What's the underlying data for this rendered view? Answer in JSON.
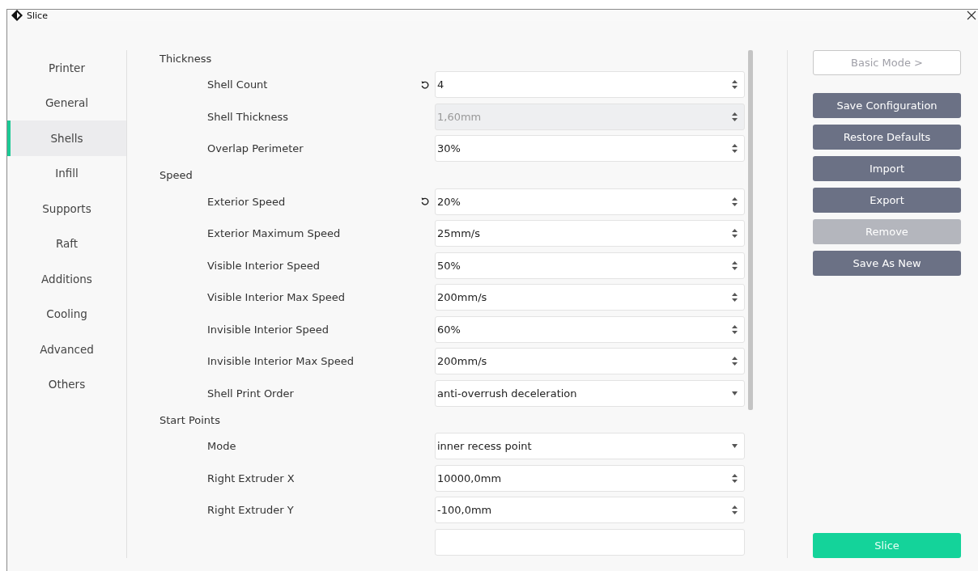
{
  "window": {
    "title": "Slice"
  },
  "sidebar": {
    "items": [
      {
        "label": "Printer",
        "selected": false
      },
      {
        "label": "General",
        "selected": false
      },
      {
        "label": "Shells",
        "selected": true
      },
      {
        "label": "Infill",
        "selected": false
      },
      {
        "label": "Supports",
        "selected": false
      },
      {
        "label": "Raft",
        "selected": false
      },
      {
        "label": "Additions",
        "selected": false
      },
      {
        "label": "Cooling",
        "selected": false
      },
      {
        "label": "Advanced",
        "selected": false
      },
      {
        "label": "Others",
        "selected": false
      }
    ]
  },
  "settings": [
    {
      "kind": "header",
      "label": "Thickness"
    },
    {
      "kind": "setting",
      "label": "Shell Count",
      "modified": true,
      "field": {
        "kind": "spin",
        "value": "4",
        "disabled": false
      }
    },
    {
      "kind": "setting",
      "label": "Shell Thickness",
      "modified": false,
      "field": {
        "kind": "spin",
        "value": "1,60mm",
        "disabled": true
      }
    },
    {
      "kind": "setting",
      "label": "Overlap Perimeter",
      "modified": false,
      "field": {
        "kind": "spin",
        "value": "30%",
        "disabled": false
      }
    },
    {
      "kind": "header",
      "label": "Speed"
    },
    {
      "kind": "setting",
      "label": "Exterior Speed",
      "modified": true,
      "field": {
        "kind": "spin",
        "value": "20%",
        "disabled": false
      }
    },
    {
      "kind": "setting",
      "label": "Exterior Maximum Speed",
      "modified": false,
      "field": {
        "kind": "spin",
        "value": "25mm/s",
        "disabled": false
      }
    },
    {
      "kind": "setting",
      "label": "Visible Interior Speed",
      "modified": false,
      "field": {
        "kind": "spin",
        "value": "50%",
        "disabled": false
      }
    },
    {
      "kind": "setting",
      "label": "Visible Interior Max Speed",
      "modified": false,
      "field": {
        "kind": "spin",
        "value": "200mm/s",
        "disabled": false
      }
    },
    {
      "kind": "setting",
      "label": "Invisible Interior Speed",
      "modified": false,
      "field": {
        "kind": "spin",
        "value": "60%",
        "disabled": false
      }
    },
    {
      "kind": "setting",
      "label": "Invisible Interior Max Speed",
      "modified": false,
      "field": {
        "kind": "spin",
        "value": "200mm/s",
        "disabled": false
      }
    },
    {
      "kind": "top-setting",
      "label": "Shell Print Order",
      "modified": false,
      "field": {
        "kind": "select",
        "value": "anti-overrush deceleration",
        "disabled": false
      }
    },
    {
      "kind": "header",
      "label": "Start Points"
    },
    {
      "kind": "setting",
      "label": "Mode",
      "modified": false,
      "field": {
        "kind": "select",
        "value": "inner recess point",
        "disabled": false
      }
    },
    {
      "kind": "setting",
      "label": "Right Extruder X",
      "modified": false,
      "field": {
        "kind": "spin",
        "value": "10000,0mm",
        "disabled": false
      }
    },
    {
      "kind": "setting",
      "label": "Right Extruder Y",
      "modified": false,
      "field": {
        "kind": "spin",
        "value": "-100,0mm",
        "disabled": false
      }
    },
    {
      "kind": "setting",
      "field": {
        "kind": "blank"
      }
    }
  ],
  "actions": [
    {
      "label": "Basic Mode >",
      "kind": "outline"
    },
    {
      "label": "Save Configuration",
      "kind": "action",
      "disabled": false
    },
    {
      "label": "Restore Defaults",
      "kind": "action",
      "disabled": false
    },
    {
      "label": "Import",
      "kind": "action",
      "disabled": false
    },
    {
      "label": "Export",
      "kind": "action",
      "disabled": false
    },
    {
      "label": "Remove",
      "kind": "action",
      "disabled": true
    },
    {
      "label": "Save As New",
      "kind": "action",
      "disabled": false
    }
  ],
  "slice_button": {
    "label": "Slice"
  }
}
